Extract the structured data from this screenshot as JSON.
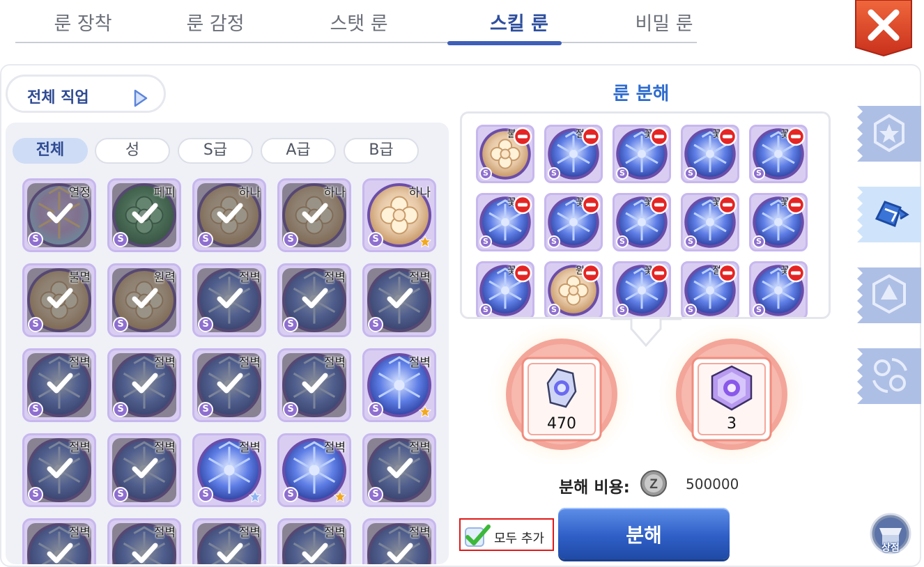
{
  "tabs": [
    {
      "label": "룬 장착"
    },
    {
      "label": "룬 감정"
    },
    {
      "label": "스탯 룬"
    },
    {
      "label": "스킬 룬"
    },
    {
      "label": "비밀 룬"
    }
  ],
  "active_tab": "스킬 룬",
  "job_filter": {
    "label": "전체 직업"
  },
  "grade_filters": [
    {
      "label": "전체"
    },
    {
      "label": "성"
    },
    {
      "label": "S급"
    },
    {
      "label": "A급"
    },
    {
      "label": "B급"
    }
  ],
  "active_grade_filter": "전체",
  "rune_list": [
    {
      "tag": "열정",
      "grade": "S",
      "selected": true,
      "type": "rainbow",
      "star": ""
    },
    {
      "tag": "페피",
      "grade": "S",
      "selected": true,
      "type": "green",
      "star": ""
    },
    {
      "tag": "하나",
      "grade": "S",
      "selected": true,
      "type": "gold",
      "star": ""
    },
    {
      "tag": "하나",
      "grade": "S",
      "selected": true,
      "type": "gold",
      "star": ""
    },
    {
      "tag": "하나",
      "grade": "S",
      "selected": false,
      "type": "gold",
      "star": "gold"
    },
    {
      "tag": "불멸",
      "grade": "S",
      "selected": true,
      "type": "gold",
      "star": ""
    },
    {
      "tag": "원력",
      "grade": "S",
      "selected": true,
      "type": "gold",
      "star": ""
    },
    {
      "tag": "절벽",
      "grade": "S",
      "selected": true,
      "type": "blue",
      "star": ""
    },
    {
      "tag": "절벽",
      "grade": "S",
      "selected": true,
      "type": "blue",
      "star": ""
    },
    {
      "tag": "절벽",
      "grade": "S",
      "selected": true,
      "type": "blue",
      "star": ""
    },
    {
      "tag": "절벽",
      "grade": "S",
      "selected": true,
      "type": "blue",
      "star": ""
    },
    {
      "tag": "절벽",
      "grade": "S",
      "selected": true,
      "type": "blue",
      "star": ""
    },
    {
      "tag": "절벽",
      "grade": "S",
      "selected": true,
      "type": "blue",
      "star": ""
    },
    {
      "tag": "절벽",
      "grade": "S",
      "selected": true,
      "type": "blue",
      "star": ""
    },
    {
      "tag": "절벽",
      "grade": "S",
      "selected": false,
      "type": "blue",
      "star": "gold"
    },
    {
      "tag": "절벽",
      "grade": "S",
      "selected": true,
      "type": "blue",
      "star": ""
    },
    {
      "tag": "절벽",
      "grade": "S",
      "selected": true,
      "type": "blue",
      "star": ""
    },
    {
      "tag": "절벽",
      "grade": "S",
      "selected": false,
      "type": "blue",
      "star": "blue"
    },
    {
      "tag": "절벽",
      "grade": "S",
      "selected": false,
      "type": "blue",
      "star": "gold"
    },
    {
      "tag": "절벽",
      "grade": "S",
      "selected": true,
      "type": "blue",
      "star": ""
    },
    {
      "tag": "절벽",
      "grade": "S",
      "selected": true,
      "type": "blue",
      "star": ""
    },
    {
      "tag": "절벽",
      "grade": "S",
      "selected": true,
      "type": "blue",
      "star": ""
    },
    {
      "tag": "절벽",
      "grade": "S",
      "selected": true,
      "type": "blue",
      "star": ""
    },
    {
      "tag": "절벽",
      "grade": "S",
      "selected": true,
      "type": "blue",
      "star": ""
    },
    {
      "tag": "절벽",
      "grade": "S",
      "selected": true,
      "type": "blue",
      "star": ""
    }
  ],
  "decompose": {
    "title": "룬 분해",
    "selected_runes": [
      {
        "tag": "불",
        "type": "gold"
      },
      {
        "tag": "절",
        "type": "blue"
      },
      {
        "tag": "꽃",
        "type": "blue"
      },
      {
        "tag": "꽃",
        "type": "blue"
      },
      {
        "tag": "꽃",
        "type": "blue"
      },
      {
        "tag": "꽃",
        "type": "blue"
      },
      {
        "tag": "꽃",
        "type": "blue"
      },
      {
        "tag": "꽃",
        "type": "blue"
      },
      {
        "tag": "꽃",
        "type": "blue"
      },
      {
        "tag": "꽃",
        "type": "blue"
      },
      {
        "tag": "꽃",
        "type": "blue"
      },
      {
        "tag": "원",
        "type": "gold"
      },
      {
        "tag": "꽃",
        "type": "blue"
      },
      {
        "tag": "절",
        "type": "blue"
      },
      {
        "tag": "꽃",
        "type": "blue"
      }
    ],
    "results": [
      {
        "value": "470",
        "icon": "rune-shard-icon"
      },
      {
        "value": "3",
        "icon": "rune-crystal-icon"
      }
    ],
    "cost_label": "분해 비용:",
    "cost_value": "500000",
    "add_all_label": "모두 추가",
    "decompose_label": "분해"
  },
  "shop_label": "상점",
  "colors": {
    "accent_blue": "#2e6cd0",
    "tab_active": "#2e4f9e",
    "close_red": "#e2452a",
    "rune_frame": "#c7b7ee"
  }
}
